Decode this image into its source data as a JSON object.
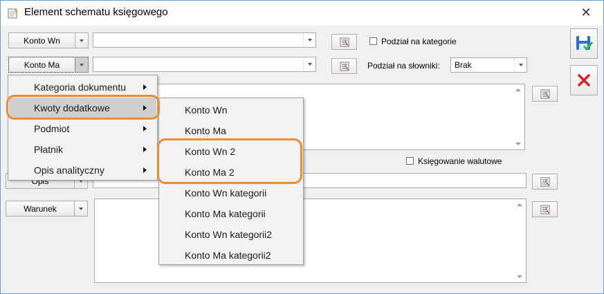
{
  "window": {
    "title": "Element schematu księgowego",
    "close_symbol": "✕"
  },
  "row_wn": {
    "button_label": "Konto Wn",
    "combo_value": ""
  },
  "row_ma": {
    "button_label": "Konto Ma",
    "combo_value": ""
  },
  "options": {
    "podzial_kategorie_label": "Podział na kategorie",
    "podzial_kategorie_checked": false,
    "podzial_slowniki_label": "Podział na słowniki:",
    "podzial_slowniki_value": "Brak",
    "ksiegowanie_walutowe_label": "Księgowanie walutowe",
    "ksiegowanie_walutowe_checked": false
  },
  "opis": {
    "button_label": "Opis",
    "value": ""
  },
  "warunek": {
    "button_label": "Warunek",
    "value": ""
  },
  "context_menu": {
    "items": [
      {
        "label": "Kategoria dokumentu",
        "has_submenu": true
      },
      {
        "label": "Kwoty dodatkowe",
        "has_submenu": true,
        "highlighted": true
      },
      {
        "label": "Podmiot",
        "has_submenu": true
      },
      {
        "label": "Płatnik",
        "has_submenu": true
      },
      {
        "label": "Opis analityczny",
        "has_submenu": true
      }
    ]
  },
  "submenu": {
    "items": [
      {
        "label": "Konto Wn"
      },
      {
        "label": "Konto Ma"
      },
      {
        "label": "Konto Wn 2"
      },
      {
        "label": "Konto Ma 2"
      },
      {
        "label": "Konto Wn kategorii"
      },
      {
        "label": "Konto Ma kategorii"
      },
      {
        "label": "Konto Wn kategorii2"
      },
      {
        "label": "Konto Ma kategorii2"
      }
    ]
  },
  "icons": {
    "window_icon": "schema-icon",
    "save": "save-icon",
    "cancel": "cancel-icon",
    "formula": "formula-icon",
    "dropdown": "chevron-down-icon",
    "submenu_arrow": "chevron-right-icon"
  },
  "colors": {
    "highlight_ring": "#f28a30",
    "save_blue": "#2c6fd1",
    "cancel_red": "#e02020",
    "menu_highlight": "#cfcfcf"
  }
}
